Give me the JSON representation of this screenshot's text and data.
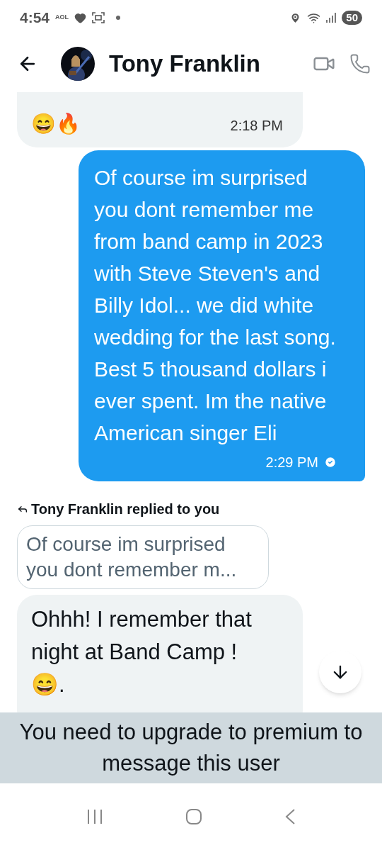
{
  "status_bar": {
    "time": "4:54",
    "carrier": "AOL",
    "battery": "50"
  },
  "header": {
    "name": "Tony Franklin"
  },
  "messages": [
    {
      "kind": "received",
      "emoji": "😄🔥",
      "time": "2:18 PM",
      "cut_top": true
    },
    {
      "kind": "sent",
      "text": "Of course im surprised you dont remember me from band camp in 2023 with Steve Steven's and Billy Idol... we did white wedding for the last song. Best 5 thousand dollars i ever spent. Im the native American singer Eli",
      "time": "2:29 PM",
      "seen": true
    },
    {
      "kind": "reply",
      "label": "Tony Franklin replied to you",
      "quote": "Of course im surprised you dont remember m...",
      "text": "Ohhh! I remember that night at Band Camp !",
      "emoji": "😄."
    }
  ],
  "notice": "You need to upgrade to premium to message this user"
}
